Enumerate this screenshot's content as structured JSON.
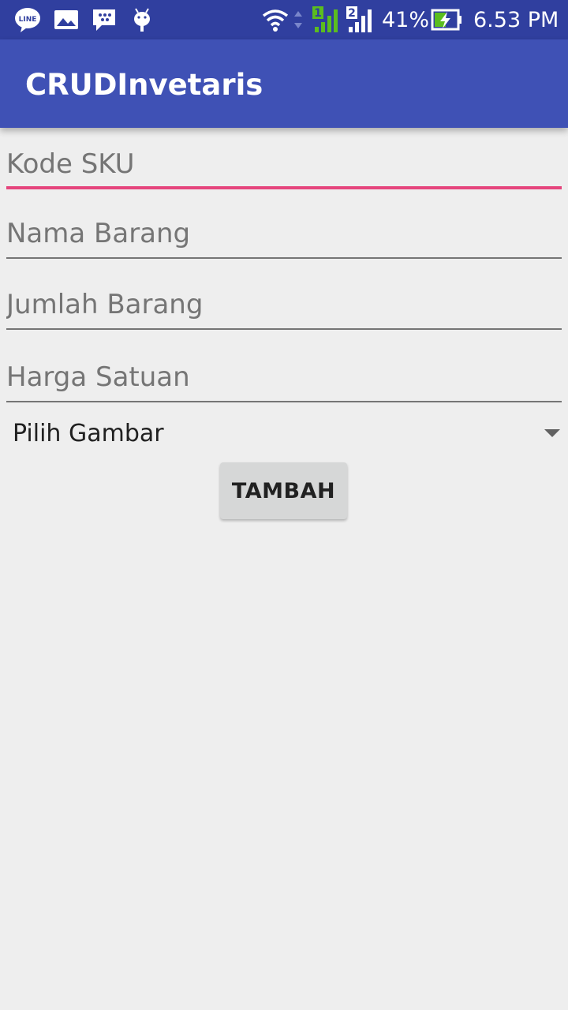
{
  "status_bar": {
    "battery": "41%",
    "time": "6.53 PM",
    "sim1_label": "1",
    "sim2_label": "2",
    "line_label": "LINE",
    "icons": [
      "line-icon",
      "gallery-icon",
      "bbm-icon",
      "android-debug-icon",
      "wifi-icon",
      "data-arrows-icon",
      "signal-sim1-icon",
      "signal-sim2-icon",
      "battery-charging-icon"
    ]
  },
  "app_bar": {
    "title": "CRUDInvetaris",
    "color": "#3f51b5"
  },
  "form": {
    "kode_sku": {
      "placeholder": "Kode SKU",
      "value": ""
    },
    "nama_barang": {
      "placeholder": "Nama Barang",
      "value": ""
    },
    "jumlah_barang": {
      "placeholder": "Jumlah Barang",
      "value": ""
    },
    "harga_satuan": {
      "placeholder": "Harga Satuan",
      "value": ""
    },
    "pilih_gambar": {
      "selected": "Pilih Gambar"
    },
    "submit_label": "TAMBAH"
  },
  "colors": {
    "status_bar": "#303f9f",
    "accent": "#e5457d",
    "background": "#eeeeee"
  }
}
